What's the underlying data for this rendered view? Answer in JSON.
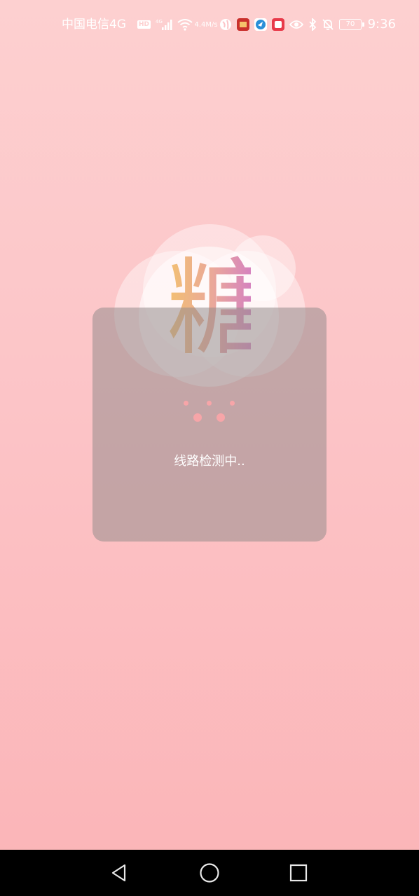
{
  "status_bar": {
    "carrier": "中国电信4G",
    "hd_badge": "HD",
    "signal_label": "4G",
    "net_speed_value": "4.4",
    "net_speed_unit": "M/s",
    "battery": "70",
    "time": "9:36"
  },
  "logo": {
    "character": "糖"
  },
  "loading": {
    "text": "线路检测中.."
  },
  "colors": {
    "background_top": "#fdd0d0",
    "background_bottom": "#fbb4b7",
    "dialog": "#968c8c",
    "dots": "#f7a5a8",
    "nav_bar": "#000000"
  },
  "icons": {
    "status": [
      "hd-icon",
      "signal-icon",
      "wifi-icon",
      "net-speed",
      "app-icon",
      "app-icon",
      "app-icon",
      "app-icon",
      "eye-icon",
      "bluetooth-icon",
      "bell-off-icon",
      "battery-icon"
    ],
    "nav": [
      "back-icon",
      "home-icon",
      "recents-icon"
    ]
  }
}
